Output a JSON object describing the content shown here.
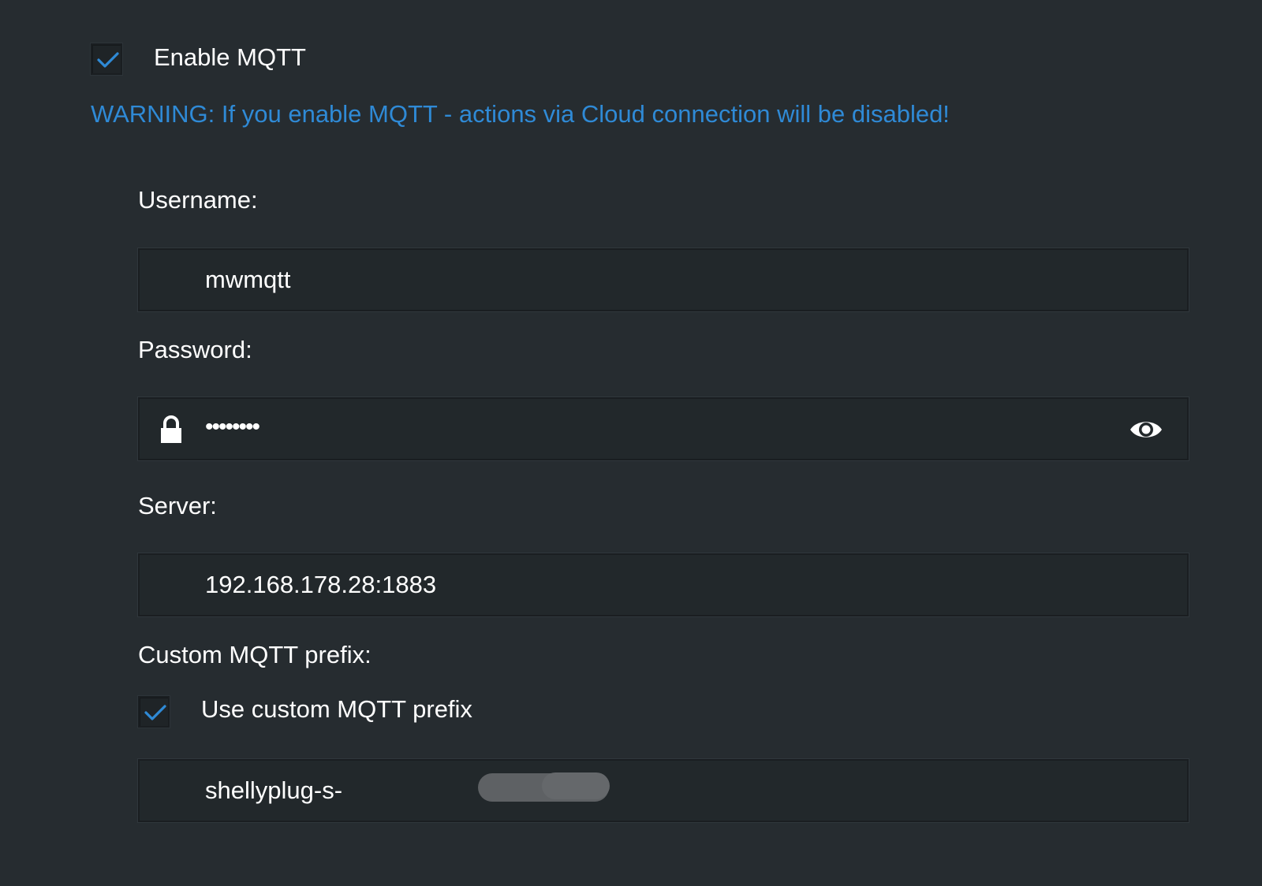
{
  "mqtt": {
    "enable_label": "Enable MQTT",
    "enable_checked": true,
    "warning": "WARNING: If you enable MQTT - actions via Cloud connection will be disabled!"
  },
  "username": {
    "label": "Username:",
    "value": "mwmqtt"
  },
  "password": {
    "label": "Password:",
    "value": "••••••••",
    "lock_icon": "lock-icon",
    "reveal_icon": "eye-icon"
  },
  "server": {
    "label": "Server:",
    "value": "192.168.178.28:1883"
  },
  "prefix": {
    "label": "Custom MQTT prefix:",
    "use_custom_label": "Use custom MQTT prefix",
    "use_custom_checked": true,
    "value": "shellyplug-s-"
  },
  "colors": {
    "background": "#262c30",
    "accent": "#2f8ad6",
    "text": "#ffffff"
  }
}
